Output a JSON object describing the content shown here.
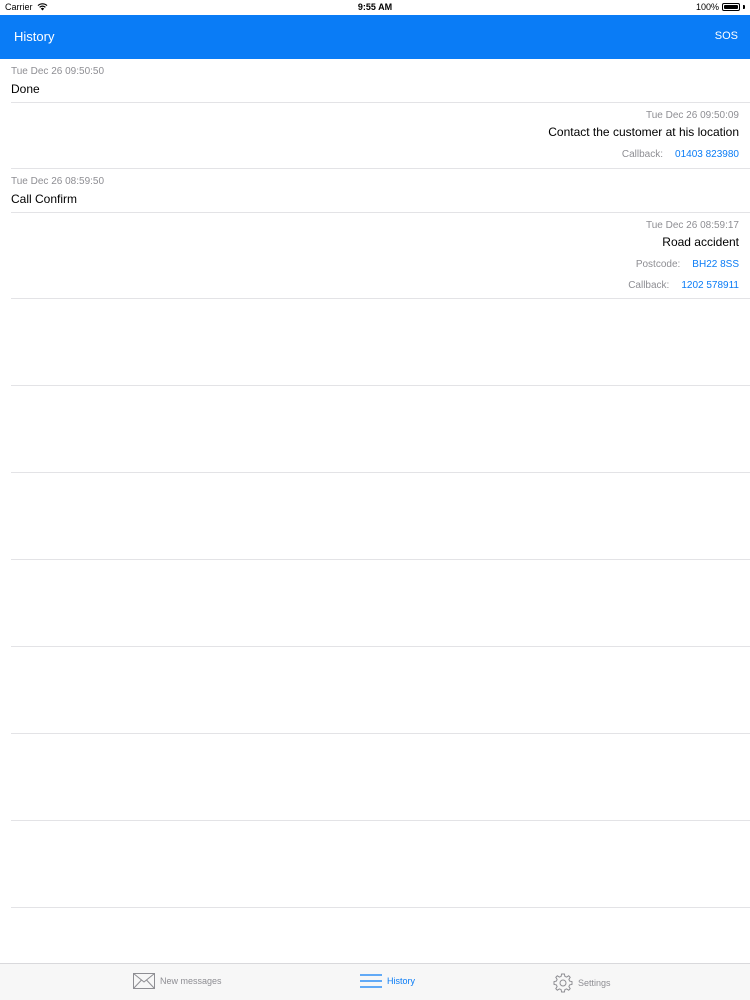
{
  "status": {
    "carrier": "Carrier",
    "time": "9:55 AM",
    "battery": "100%",
    "battery_level": 1.0
  },
  "nav": {
    "title": "History",
    "right_action": "SOS"
  },
  "history": [
    {
      "timestamp": "Tue Dec 26 09:50:50",
      "text": "Done"
    },
    {
      "timestamp": "Tue Dec 26 09:50:09",
      "text": "Contact the customer at his location",
      "callback_label": "Callback:",
      "callback": "01403 823980"
    },
    {
      "timestamp": "Tue Dec 26 08:59:50",
      "text": "Call Confirm"
    },
    {
      "timestamp": "Tue Dec 26 08:59:17",
      "text": "Road accident",
      "postcode_label": "Postcode:",
      "postcode": "BH22 8SS",
      "callback_label": "Callback:",
      "callback": "1202 578911"
    }
  ],
  "tabs": [
    {
      "label": "New messages",
      "icon": "envelope-icon"
    },
    {
      "label": "History",
      "icon": "list-icon",
      "active": true
    },
    {
      "label": "Settings",
      "icon": "gear-icon"
    }
  ],
  "colors": {
    "accent": "#0a7cf6",
    "secondary_text": "#8e8e93",
    "separator": "#e3e3e6"
  }
}
